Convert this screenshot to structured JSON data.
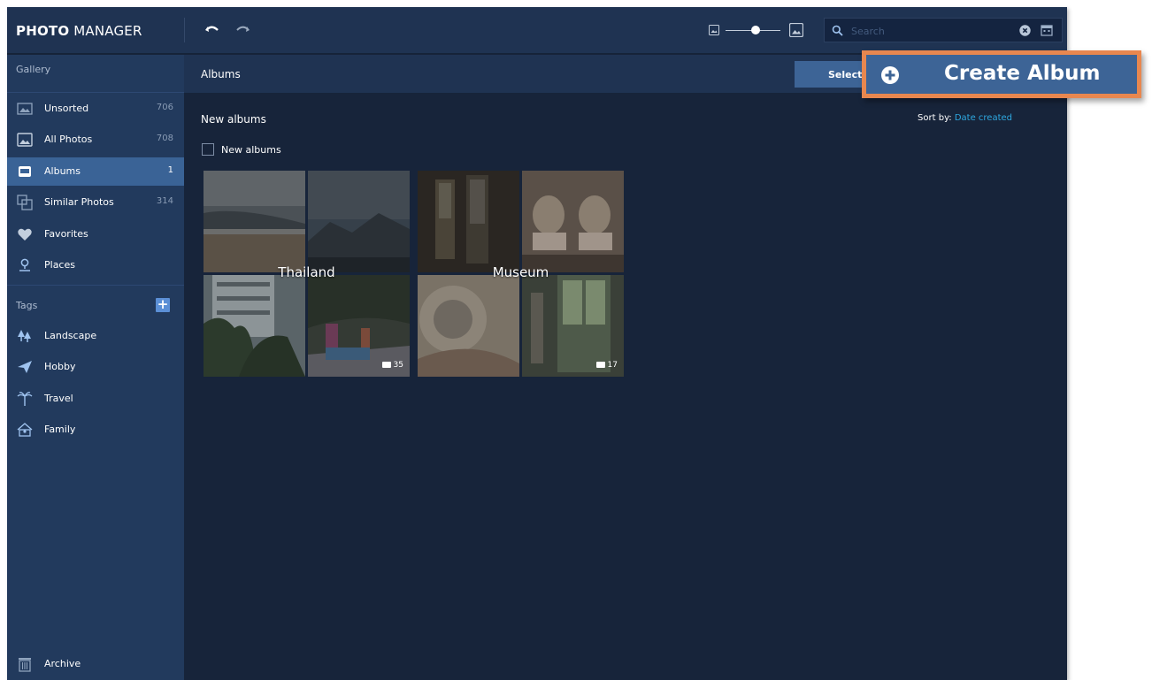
{
  "app": {
    "brand_bold": "PHOTO",
    "brand_light": "MANAGER"
  },
  "toolbar": {
    "search_placeholder": "Search",
    "zoom_level_fraction": 0.55
  },
  "sidebar": {
    "gallery_heading": "Gallery",
    "items": [
      {
        "label": "Unsorted",
        "count": "706",
        "icon": "unsorted-icon"
      },
      {
        "label": "All Photos",
        "count": "708",
        "icon": "photos-icon"
      },
      {
        "label": "Albums",
        "count": "1",
        "icon": "albums-icon",
        "active": true
      },
      {
        "label": "Similar Photos",
        "count": "314",
        "icon": "similar-photos-icon"
      },
      {
        "label": "Favorites",
        "count": "",
        "icon": "heart-icon"
      },
      {
        "label": "Places",
        "count": "",
        "icon": "map-pin-icon"
      }
    ],
    "tags_heading": "Tags",
    "tags": [
      {
        "label": "Landscape",
        "icon": "trees-icon"
      },
      {
        "label": "Hobby",
        "icon": "paper-plane-icon"
      },
      {
        "label": "Travel",
        "icon": "palm-tree-icon"
      },
      {
        "label": "Family",
        "icon": "family-house-icon"
      }
    ],
    "archive_label": "Archive"
  },
  "main": {
    "title": "Albums",
    "select_label": "Select",
    "group_title": "New albums",
    "sort_label": "Sort by:",
    "sort_value": "Date created",
    "checkbox_label": "New albums",
    "albums": [
      {
        "name": "Thailand",
        "count": "35"
      },
      {
        "name": "Museum",
        "count": "17"
      }
    ]
  },
  "callout": {
    "label": "Create Album",
    "border_color": "#e8874f",
    "fill_color": "#3d6496"
  },
  "colors": {
    "accent": "#2ea8e0",
    "sidebar_active": "#3a6396",
    "background": "#17243a"
  }
}
